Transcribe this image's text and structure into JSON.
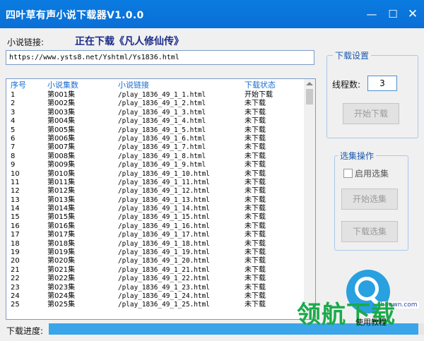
{
  "window": {
    "title": "四叶草有声小说下载器V1.0.0",
    "minimize": "—",
    "maximize": "☐",
    "close": "✕"
  },
  "url": {
    "label": "小说链接:",
    "downloading_text": "正在下载《凡人修仙传》",
    "value": "https://www.ysts8.net/Yshtml/Ys1836.html"
  },
  "list": {
    "headers": [
      "序号",
      "小说集数",
      "小说链接",
      "下载状态"
    ],
    "rows": [
      [
        "1",
        "第001集",
        "/play_1836_49_1_1.html",
        "开始下载"
      ],
      [
        "2",
        "第002集",
        "/play_1836_49_1_2.html",
        "未下载"
      ],
      [
        "3",
        "第003集",
        "/play_1836_49_1_3.html",
        "未下载"
      ],
      [
        "4",
        "第004集",
        "/play_1836_49_1_4.html",
        "未下载"
      ],
      [
        "5",
        "第005集",
        "/play_1836_49_1_5.html",
        "未下载"
      ],
      [
        "6",
        "第006集",
        "/play_1836_49_1_6.html",
        "未下载"
      ],
      [
        "7",
        "第007集",
        "/play_1836_49_1_7.html",
        "未下载"
      ],
      [
        "8",
        "第008集",
        "/play_1836_49_1_8.html",
        "未下载"
      ],
      [
        "9",
        "第009集",
        "/play_1836_49_1_9.html",
        "未下载"
      ],
      [
        "10",
        "第010集",
        "/play_1836_49_1_10.html",
        "未下载"
      ],
      [
        "11",
        "第011集",
        "/play_1836_49_1_11.html",
        "未下载"
      ],
      [
        "12",
        "第012集",
        "/play_1836_49_1_12.html",
        "未下载"
      ],
      [
        "13",
        "第013集",
        "/play_1836_49_1_13.html",
        "未下载"
      ],
      [
        "14",
        "第014集",
        "/play_1836_49_1_14.html",
        "未下载"
      ],
      [
        "15",
        "第015集",
        "/play_1836_49_1_15.html",
        "未下载"
      ],
      [
        "16",
        "第016集",
        "/play_1836_49_1_16.html",
        "未下载"
      ],
      [
        "17",
        "第017集",
        "/play_1836_49_1_17.html",
        "未下载"
      ],
      [
        "18",
        "第018集",
        "/play_1836_49_1_18.html",
        "未下载"
      ],
      [
        "19",
        "第019集",
        "/play_1836_49_1_19.html",
        "未下载"
      ],
      [
        "20",
        "第020集",
        "/play_1836_49_1_20.html",
        "未下载"
      ],
      [
        "21",
        "第021集",
        "/play_1836_49_1_21.html",
        "未下载"
      ],
      [
        "22",
        "第022集",
        "/play_1836_49_1_22.html",
        "未下载"
      ],
      [
        "23",
        "第023集",
        "/play_1836_49_1_23.html",
        "未下载"
      ],
      [
        "24",
        "第024集",
        "/play_1836_49_1_24.html",
        "未下载"
      ],
      [
        "25",
        "第025集",
        "/play_1836_49_1_25.html",
        "未下载"
      ]
    ]
  },
  "progress": {
    "label": "下载进度:",
    "percent": 98
  },
  "settings": {
    "title": "下载设置",
    "thread_label": "线程数:",
    "thread_value": "3",
    "start_button": "开始下载"
  },
  "selection": {
    "title": "选集操作",
    "enable_label": "启用选集",
    "start_button": "开始选集",
    "download_button": "下载选集"
  },
  "watermark": {
    "site": "lhdown.com",
    "big_text": "领航下载",
    "tutorial": "使用教程"
  },
  "icons": {
    "window_controls": [
      "minimize-icon",
      "maximize-icon",
      "close-icon"
    ],
    "logo": "magnifier-logo-icon"
  },
  "colors": {
    "titlebar": "#0a7be0",
    "header_text": "#1a6fd0",
    "downloading_text": "#1a2c8a",
    "progress_fill": "#3aa5e8",
    "watermark_green": "#1aaa4a"
  }
}
